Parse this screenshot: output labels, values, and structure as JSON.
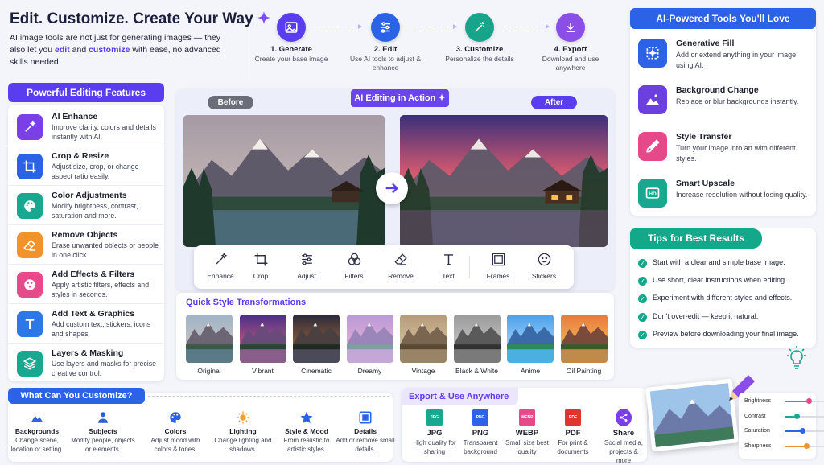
{
  "header": {
    "title": "Edit. Customize. Create Your Way",
    "intro_prefix": "AI image tools are not just for generating images — they also let you ",
    "intro_edit": "edit",
    "intro_mid": " and ",
    "intro_customize": "customize",
    "intro_suffix": " with ease, no advanced skills needed."
  },
  "steps": [
    {
      "title": "1. Generate",
      "desc": "Create your base image",
      "icon": "image-icon",
      "color": "#5b3df0"
    },
    {
      "title": "2. Edit",
      "desc": "Use AI tools to adjust & enhance",
      "icon": "sliders-icon",
      "color": "#2c63e6"
    },
    {
      "title": "3. Customize",
      "desc": "Personalize the details",
      "icon": "magic-wand-icon",
      "color": "#16a48a"
    },
    {
      "title": "4. Export",
      "desc": "Download and use anywhere",
      "icon": "download-icon",
      "color": "#8b4ee6"
    }
  ],
  "features": {
    "heading": "Powerful Editing Features",
    "items": [
      {
        "title": "AI Enhance",
        "desc": "Improve clarity, colors and details instantly with AI.",
        "icon": "sparkle-wand-icon",
        "color": "#7b3fe8"
      },
      {
        "title": "Crop & Resize",
        "desc": "Adjust size, crop, or change aspect ratio easily.",
        "icon": "crop-icon",
        "color": "#2c63e6"
      },
      {
        "title": "Color Adjustments",
        "desc": "Modify brightness, contrast, saturation and more.",
        "icon": "palette-icon",
        "color": "#17a88f"
      },
      {
        "title": "Remove Objects",
        "desc": "Erase unwanted objects or people in one click.",
        "icon": "eraser-icon",
        "color": "#f2922b"
      },
      {
        "title": "Add Effects & Filters",
        "desc": "Apply artistic filters, effects and styles in seconds.",
        "icon": "effects-icon",
        "color": "#e64a8a"
      },
      {
        "title": "Add Text & Graphics",
        "desc": "Add custom text, stickers, icons and shapes.",
        "icon": "text-icon",
        "color": "#2c78e6"
      },
      {
        "title": "Layers & Masking",
        "desc": "Use layers and masks for precise creative control.",
        "icon": "layers-icon",
        "color": "#17a88f"
      }
    ]
  },
  "editor": {
    "badge": "AI Editing in Action",
    "before": "Before",
    "after": "After",
    "tools": [
      "Enhance",
      "Crop",
      "Adjust",
      "Filters",
      "Remove",
      "Text",
      "Frames",
      "Stickers"
    ]
  },
  "styles": {
    "heading": "Quick Style Transformations",
    "items": [
      "Original",
      "Vibrant",
      "Cinematic",
      "Dreamy",
      "Vintage",
      "Black & White",
      "Anime",
      "Oil Painting"
    ]
  },
  "ai_tools": {
    "heading": "AI-Powered Tools You'll Love",
    "items": [
      {
        "title": "Generative Fill",
        "desc": "Add or extend anything in your image using AI.",
        "icon": "generative-fill-icon",
        "color": "#2c63e6"
      },
      {
        "title": "Background Change",
        "desc": "Replace or blur backgrounds instantly.",
        "icon": "landscape-icon",
        "color": "#6b3fe0"
      },
      {
        "title": "Style Transfer",
        "desc": "Turn your image into art with different styles.",
        "icon": "brush-icon",
        "color": "#e6498a"
      },
      {
        "title": "Smart Upscale",
        "desc": "Increase resolution without losing quality.",
        "icon": "hd-icon",
        "color": "#17a88f"
      }
    ]
  },
  "tips": {
    "heading": "Tips for Best Results",
    "items": [
      "Start with a clear and simple base image.",
      "Use short, clear instructions when editing.",
      "Experiment with different styles and effects.",
      "Don't over-edit — keep it natural.",
      "Preview before downloading your final image."
    ]
  },
  "customize": {
    "heading": "What Can You Customize?",
    "items": [
      {
        "title": "Backgrounds",
        "desc": "Change scene, location or setting.",
        "icon": "mountain-icon",
        "color": "#2c63e6"
      },
      {
        "title": "Subjects",
        "desc": "Modify people, objects or elements.",
        "icon": "person-icon",
        "color": "#2c63e6"
      },
      {
        "title": "Colors",
        "desc": "Adjust mood with colors & tones.",
        "icon": "palette-icon",
        "color": "#2c63e6"
      },
      {
        "title": "Lighting",
        "desc": "Change lighting and shadows.",
        "icon": "sun-icon",
        "color": "#f2a12b"
      },
      {
        "title": "Style & Mood",
        "desc": "From realistic to artistic styles.",
        "icon": "star-icon",
        "color": "#2c63e6"
      },
      {
        "title": "Details",
        "desc": "Add or remove small details.",
        "icon": "details-icon",
        "color": "#2c63e6"
      }
    ]
  },
  "export": {
    "heading": "Export & Use Anywhere",
    "items": [
      {
        "title": "JPG",
        "desc": "High quality for sharing",
        "color": "#17a88f"
      },
      {
        "title": "PNG",
        "desc": "Transparent background",
        "color": "#2c63e6"
      },
      {
        "title": "WEBP",
        "desc": "Small size best quality",
        "color": "#e6498a"
      },
      {
        "title": "PDF",
        "desc": "For print & documents",
        "color": "#e0342f"
      },
      {
        "title": "Share",
        "desc": "Social media, projects & more",
        "color": "#7b3fe8"
      }
    ]
  },
  "sliders": [
    {
      "label": "Brightness",
      "value": 0.6,
      "color": "#e6498a"
    },
    {
      "label": "Contrast",
      "value": 0.3,
      "color": "#17a88f"
    },
    {
      "label": "Saturation",
      "value": 0.45,
      "color": "#2c63e6"
    },
    {
      "label": "Sharpness",
      "value": 0.55,
      "color": "#f2922b"
    }
  ]
}
